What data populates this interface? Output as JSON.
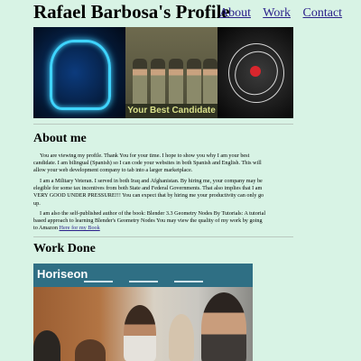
{
  "header": {
    "title": "Rafael Barbosa's Profile",
    "nav": {
      "about": "About",
      "work": "Work",
      "contact": "Contact"
    }
  },
  "banner": {
    "caption": "Your Best Candidate"
  },
  "about": {
    "heading": "About me",
    "p1": "You are viewing my profile. Thank You for your time. I hope to show you why I am your best candidate. I am bilingual (Spanish) so I can code your websites in both Spanish and English. This will allow your web development company to tab into a larger marketplace.",
    "p2": "I am a Military Veteran. I served in both Iraq and Afghanistan. By hiring me, your company may be elegible for some tax incentives from both State and Federal Governments. That also implies that I am VERY GOOD UNDER PRESSURE!!! You can expect that by hiring me your productivity can only go up.",
    "p3": "I am also the self-published author of the book: Blender 3.3 Geometry Nodes By Tutorials: A tutorial based approach to learning Blender's Geometry Nodes You may view the quality of my work by going to Amazon",
    "book_link": "Here for my Book"
  },
  "work": {
    "heading": "Work Done",
    "card_logo": "Horiseon"
  }
}
